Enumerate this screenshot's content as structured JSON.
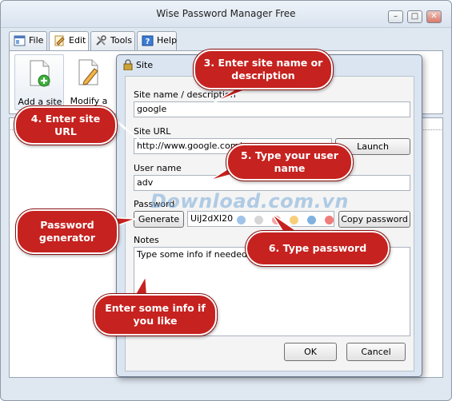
{
  "window": {
    "title": "Wise Password Manager Free",
    "minimize_glyph": "–",
    "maximize_glyph": "□",
    "close_glyph": "✕"
  },
  "tabs": [
    {
      "label": "File",
      "icon": "file-icon"
    },
    {
      "label": "Edit",
      "icon": "edit-icon",
      "active": true
    },
    {
      "label": "Tools",
      "icon": "tools-icon"
    },
    {
      "label": "Help",
      "icon": "help-icon"
    }
  ],
  "ribbon": {
    "add_site": "Add a site",
    "modify_site": "Modify a site"
  },
  "dialog": {
    "title": "Site",
    "site_name_label": "Site name / description",
    "site_name_value": "google",
    "site_url_label": "Site URL",
    "site_url_value": "http://www.google.com/",
    "launch_button": "Launch",
    "user_name_label": "User name",
    "user_name_value": "adv",
    "password_label": "Password",
    "generate_button": "Generate",
    "password_value": "UiJ2dXI20",
    "copy_password_button": "Copy password",
    "notes_label": "Notes",
    "notes_value": "Type some info if needed",
    "ok_button": "OK",
    "cancel_button": "Cancel"
  },
  "callouts": {
    "site_name": "3. Enter site name or description",
    "site_url": "4. Enter site URL",
    "user_name": "5. Type your user name",
    "password": "6. Type password",
    "generator": "Password generator",
    "notes": "Enter some info if you like"
  },
  "watermark": {
    "text": "Download.com.vn",
    "dot_colors": [
      "#9fc4e8",
      "#d6d6d6",
      "#f2a3a3",
      "#f7cf7a",
      "#7fb2e0",
      "#f07c7c"
    ]
  },
  "colors": {
    "callout_red": "#c6221f",
    "window_bg": "#dfe7f1"
  }
}
